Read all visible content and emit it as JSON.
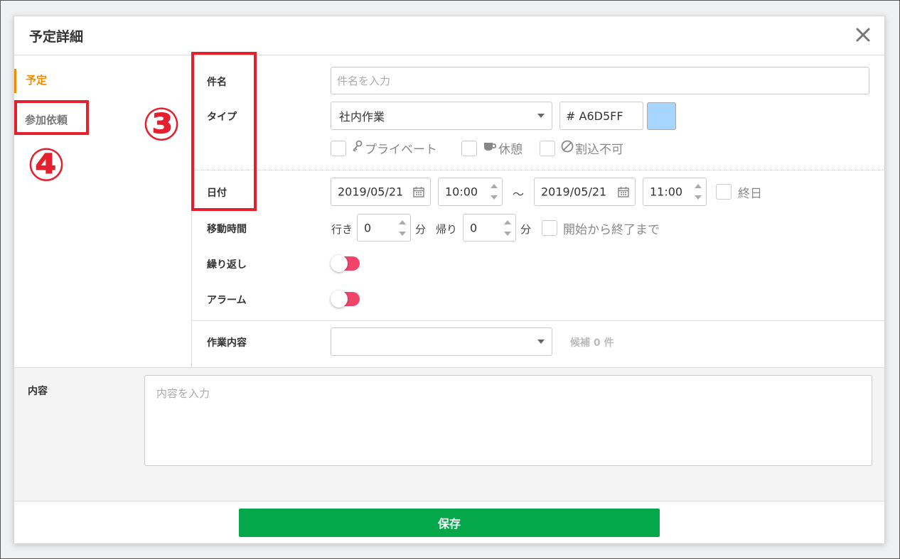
{
  "modal": {
    "title": "予定詳細"
  },
  "sidebar": {
    "items": [
      {
        "label": "予定"
      },
      {
        "label": "参加依頼"
      }
    ]
  },
  "form": {
    "title_label": "件名",
    "title_placeholder": "件名を入力",
    "type_label": "タイプ",
    "type_value": "社内作業",
    "color_value": "# A6D5FF",
    "swatch_color": "#A6D5FF",
    "checkboxes": [
      {
        "label": "プライベート",
        "icon": "key-icon"
      },
      {
        "label": "休憩",
        "icon": "cup-icon"
      },
      {
        "label": "割込不可",
        "icon": "no-entry-icon"
      }
    ],
    "date_label": "日付",
    "start_date": "2019/05/21",
    "start_time": "10:00",
    "range_sep": "～",
    "end_date": "2019/05/21",
    "end_time": "11:00",
    "all_day_label": "終日",
    "travel_label": "移動時間",
    "travel_go_label": "行き",
    "travel_go_value": "0",
    "travel_unit": "分",
    "travel_back_label": "帰り",
    "travel_back_value": "0",
    "travel_span_label": "開始から終了まで",
    "repeat_label": "繰り返し",
    "alarm_label": "アラーム",
    "work_label": "作業内容",
    "work_value": "",
    "work_candidates": "候補 0 件",
    "content_label": "内容",
    "content_placeholder": "内容を入力"
  },
  "footer": {
    "save_label": "保存"
  },
  "annotations": {
    "num3": "③",
    "num4": "④"
  },
  "colors": {
    "accent": "#f18a00",
    "save": "#04a84a",
    "toggle": "#f2446b",
    "annotation": "#e5202e"
  }
}
